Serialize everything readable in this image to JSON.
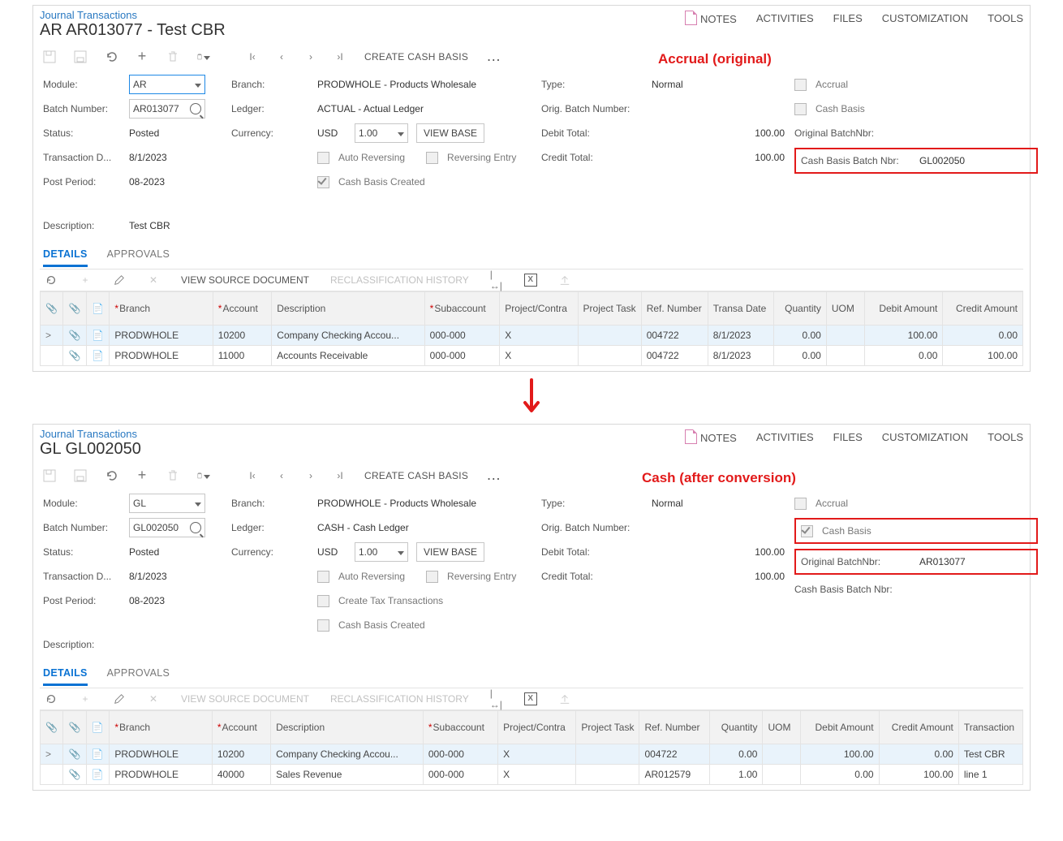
{
  "shared": {
    "menu": {
      "notes": "NOTES",
      "activities": "ACTIVITIES",
      "files": "FILES",
      "customization": "CUSTOMIZATION",
      "tools": "TOOLS"
    },
    "breadcrumb": "Journal Transactions",
    "createCashBasis": "CREATE CASH BASIS",
    "tabs": {
      "details": "DETAILS",
      "approvals": "APPROVALS"
    },
    "gridToolbar": {
      "viewSource": "VIEW SOURCE DOCUMENT",
      "reclass": "RECLASSIFICATION HISTORY"
    },
    "labels": {
      "module": "Module:",
      "batchNumber": "Batch Number:",
      "status": "Status:",
      "transDate": "Transaction D...",
      "postPeriod": "Post Period:",
      "description": "Description:",
      "branch": "Branch:",
      "ledger": "Ledger:",
      "currency": "Currency:",
      "autoRev": "Auto Reversing",
      "revEntry": "Reversing Entry",
      "cashCreated": "Cash Basis Created",
      "createTax": "Create Tax Transactions",
      "type": "Type:",
      "origBatch": "Orig. Batch Number:",
      "debitTotal": "Debit Total:",
      "creditTotal": "Credit Total:",
      "accrual": "Accrual",
      "cashBasis": "Cash Basis",
      "origBatchNbr": "Original BatchNbr:",
      "cashBasisBatchNbr": "Cash Basis Batch Nbr:",
      "viewBase": "VIEW BASE"
    },
    "cols": {
      "branch": "Branch",
      "account": "Account",
      "desc": "Description",
      "sub": "Subaccount",
      "projC": "Project/Contra",
      "projT": "Project\nTask",
      "ref": "Ref.\nNumber",
      "transDate": "Transa\nDate",
      "qty": "Quantity",
      "uom": "UOM",
      "debit": "Debit\nAmount",
      "credit": "Credit\nAmount",
      "transDesc": "Transaction"
    }
  },
  "top": {
    "title": "AR AR013077 - Test CBR",
    "annotation": "Accrual (original)",
    "fields": {
      "module": "AR",
      "batch": "AR013077",
      "status": "Posted",
      "transDate": "8/1/2023",
      "postPeriod": "08-2023",
      "description": "Test CBR",
      "branch": "PRODWHOLE - Products Wholesale",
      "ledger": "ACTUAL - Actual Ledger",
      "curCode": "USD",
      "curRate": "1.00",
      "type": "Normal",
      "origBatch": "",
      "debitTotal": "100.00",
      "creditTotal": "100.00",
      "origBatchNbr": "",
      "cashBasisBatchNbr": "GL002050"
    },
    "checks": {
      "autoRev": false,
      "revEntry": false,
      "cashCreated": true,
      "accrual": false,
      "cashBasis": false
    },
    "rows": [
      {
        "branch": "PRODWHOLE",
        "account": "10200",
        "desc": "Company Checking Accou...",
        "sub": "000-000",
        "projC": "X",
        "projT": "",
        "ref": "004722",
        "tDate": "8/1/2023",
        "qty": "0.00",
        "uom": "",
        "debit": "100.00",
        "credit": "0.00"
      },
      {
        "branch": "PRODWHOLE",
        "account": "11000",
        "desc": "Accounts Receivable",
        "sub": "000-000",
        "projC": "X",
        "projT": "",
        "ref": "004722",
        "tDate": "8/1/2023",
        "qty": "0.00",
        "uom": "",
        "debit": "0.00",
        "credit": "100.00"
      }
    ]
  },
  "bottom": {
    "title": "GL GL002050",
    "annotation": "Cash (after conversion)",
    "fields": {
      "module": "GL",
      "batch": "GL002050",
      "status": "Posted",
      "transDate": "8/1/2023",
      "postPeriod": "08-2023",
      "description": "",
      "branch": "PRODWHOLE - Products Wholesale",
      "ledger": "CASH - Cash Ledger",
      "curCode": "USD",
      "curRate": "1.00",
      "type": "Normal",
      "origBatch": "",
      "debitTotal": "100.00",
      "creditTotal": "100.00",
      "origBatchNbr": "AR013077",
      "cashBasisBatchNbr": ""
    },
    "checks": {
      "autoRev": false,
      "revEntry": false,
      "createTax": false,
      "cashCreated": false,
      "accrual": false,
      "cashBasis": true
    },
    "rows": [
      {
        "branch": "PRODWHOLE",
        "account": "10200",
        "desc": "Company Checking Accou...",
        "sub": "000-000",
        "projC": "X",
        "projT": "",
        "ref": "004722",
        "qty": "0.00",
        "uom": "",
        "debit": "100.00",
        "credit": "0.00",
        "tdesc": "Test CBR"
      },
      {
        "branch": "PRODWHOLE",
        "account": "40000",
        "desc": "Sales Revenue",
        "sub": "000-000",
        "projC": "X",
        "projT": "",
        "ref": "AR012579",
        "qty": "1.00",
        "uom": "",
        "debit": "0.00",
        "credit": "100.00",
        "tdesc": "line 1"
      }
    ]
  }
}
